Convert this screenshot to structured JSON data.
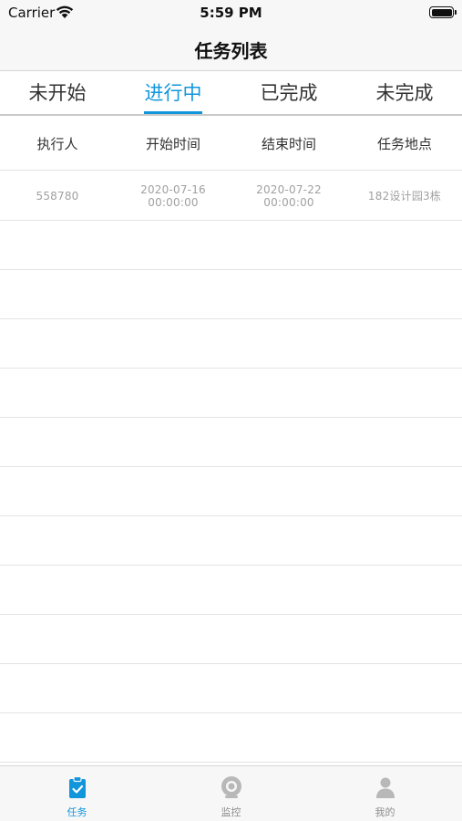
{
  "status_bar": {
    "carrier": "Carrier",
    "time": "5:59 PM"
  },
  "nav": {
    "title": "任务列表"
  },
  "tabs": [
    {
      "label": "未开始",
      "active": false
    },
    {
      "label": "进行中",
      "active": true
    },
    {
      "label": "已完成",
      "active": false
    },
    {
      "label": "未完成",
      "active": false
    }
  ],
  "table": {
    "headers": [
      "执行人",
      "开始时间",
      "结束时间",
      "任务地点"
    ],
    "rows": [
      [
        "558780",
        "2020-07-16\n00:00:00",
        "2020-07-22\n00:00:00",
        "182设计园3栋"
      ]
    ]
  },
  "bottom_tabs": [
    {
      "label": "任务",
      "icon": "clipboard-check-icon",
      "active": true
    },
    {
      "label": "监控",
      "icon": "camera-icon",
      "active": false
    },
    {
      "label": "我的",
      "icon": "person-icon",
      "active": false
    }
  ],
  "colors": {
    "accent": "#1296db",
    "inactive_icon": "#b8b8b8",
    "muted_text": "#a0a0a0"
  }
}
